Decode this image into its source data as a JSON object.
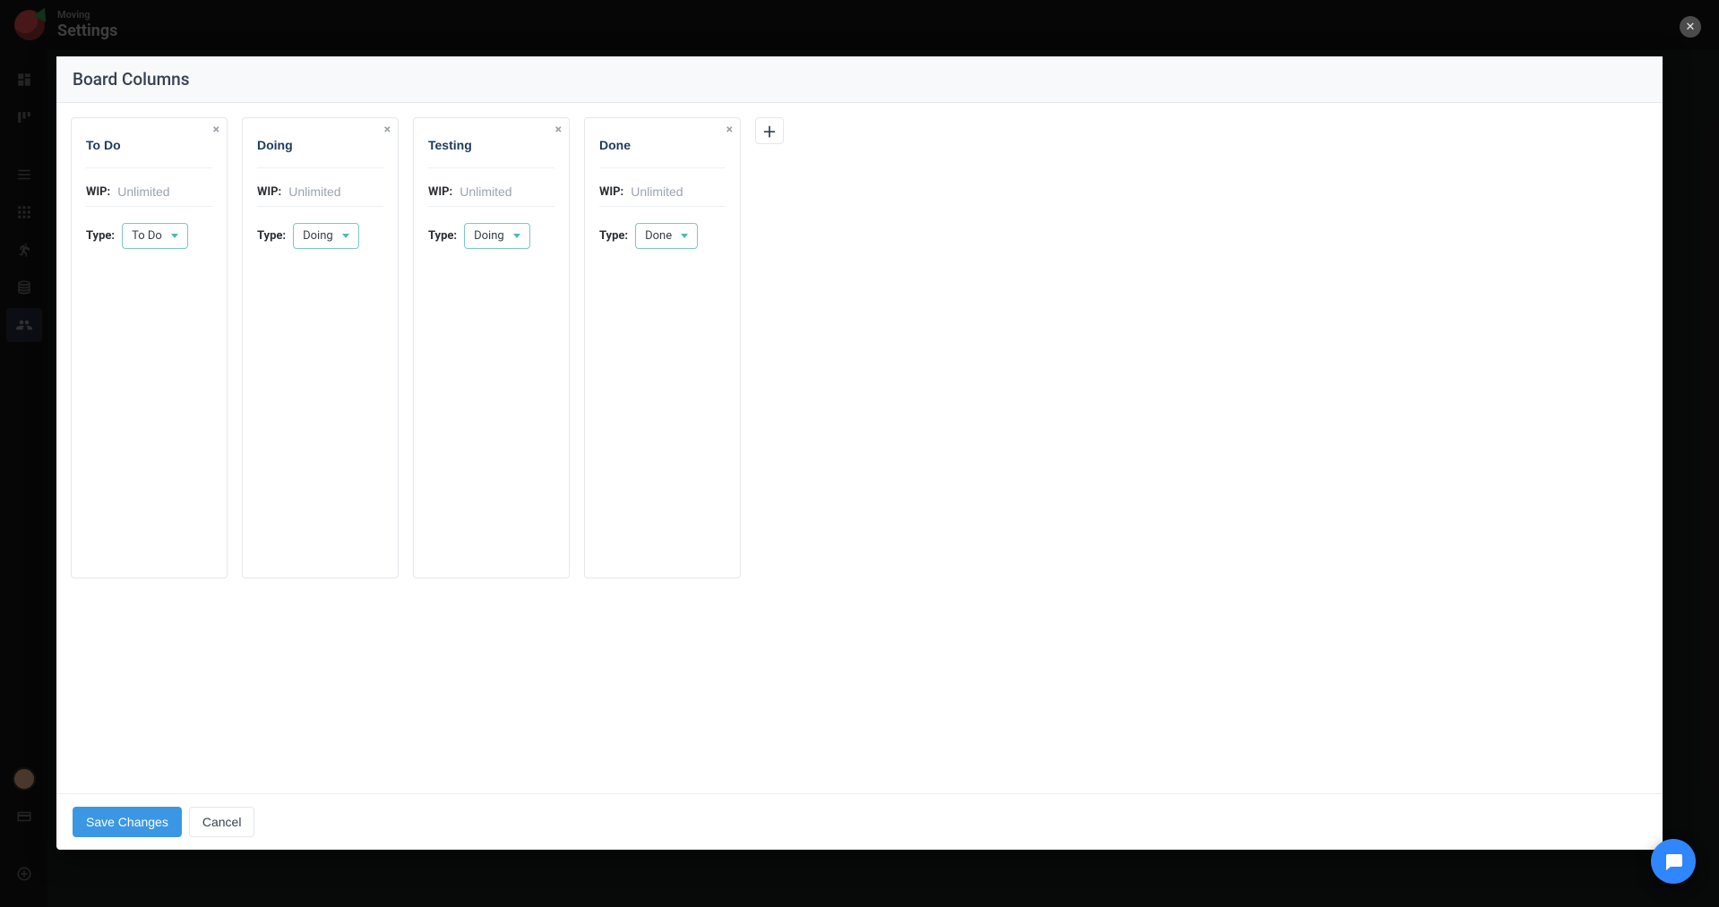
{
  "header": {
    "breadcrumb": "Moving",
    "page_title": "Settings"
  },
  "dialog": {
    "title": "Board Columns",
    "save_label": "Save Changes",
    "cancel_label": "Cancel"
  },
  "column_field_labels": {
    "wip": "WIP:",
    "type": "Type:",
    "wip_placeholder": "Unlimited"
  },
  "columns": [
    {
      "name": "To Do",
      "wip": "",
      "type": "To Do"
    },
    {
      "name": "Doing",
      "wip": "",
      "type": "Doing"
    },
    {
      "name": "Testing",
      "wip": "",
      "type": "Doing"
    },
    {
      "name": "Done",
      "wip": "",
      "type": "Done"
    }
  ],
  "sidebar": {
    "items": [
      {
        "name": "dashboard"
      },
      {
        "name": "boards"
      },
      {
        "name": "list"
      },
      {
        "name": "grid"
      },
      {
        "name": "sprints"
      },
      {
        "name": "storage"
      },
      {
        "name": "team"
      }
    ],
    "active_index": 6,
    "bottom": [
      {
        "name": "avatar"
      },
      {
        "name": "billing"
      },
      {
        "name": "add"
      }
    ]
  }
}
